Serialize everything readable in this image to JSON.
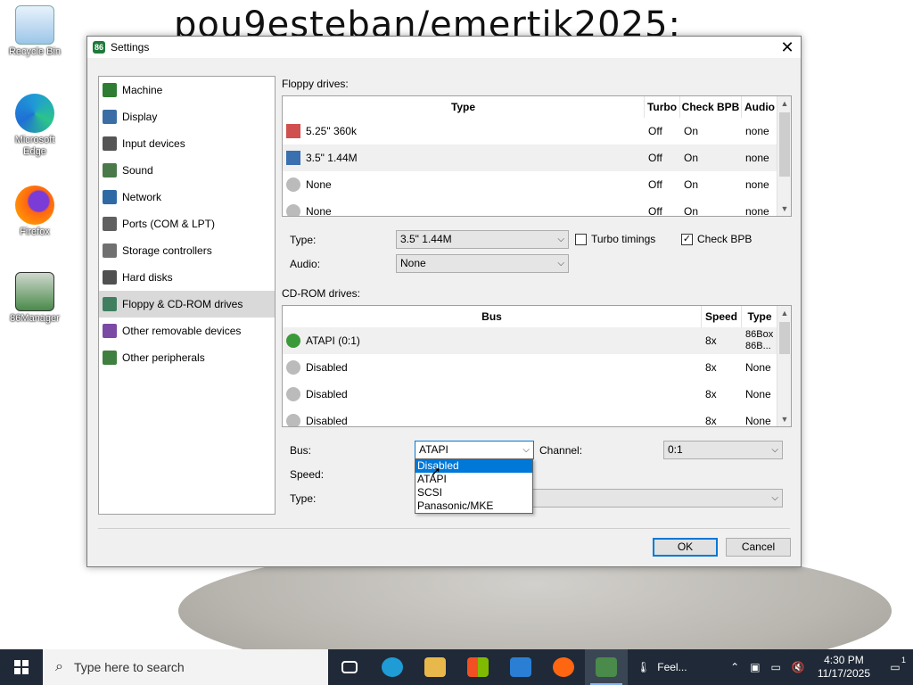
{
  "desktop": {
    "wallpaper_text": "pou9esteban/emertik2025:",
    "icons": [
      {
        "label": "Recycle Bin",
        "color": "#6aa8d8"
      },
      {
        "label": "Microsoft Edge",
        "color": "#1f9bd6"
      },
      {
        "label": "Firefox",
        "color": "#ff6611"
      },
      {
        "label": "86Manager",
        "color": "#4a8a4a"
      }
    ]
  },
  "dialog": {
    "title": "Settings",
    "close_glyph": "✕",
    "nav": [
      {
        "label": "Machine",
        "color": "#2f7d32"
      },
      {
        "label": "Display",
        "color": "#3b6ea5"
      },
      {
        "label": "Input devices",
        "color": "#555555"
      },
      {
        "label": "Sound",
        "color": "#4a7a4a"
      },
      {
        "label": "Network",
        "color": "#2f6aa5"
      },
      {
        "label": "Ports (COM & LPT)",
        "color": "#606060"
      },
      {
        "label": "Storage controllers",
        "color": "#707070"
      },
      {
        "label": "Hard disks",
        "color": "#505050"
      },
      {
        "label": "Floppy & CD-ROM drives",
        "color": "#3f7f5f"
      },
      {
        "label": "Other removable devices",
        "color": "#7a4aa5"
      },
      {
        "label": "Other peripherals",
        "color": "#3f7f3f"
      }
    ],
    "floppy": {
      "section_label": "Floppy drives:",
      "headers": {
        "type": "Type",
        "turbo": "Turbo",
        "check_bpb": "Check BPB",
        "audio": "Audio"
      },
      "rows": [
        {
          "type": "5.25\" 360k",
          "turbo": "Off",
          "check_bpb": "On",
          "audio": "none",
          "icon": "floppy-525-icon",
          "color": "#d05050"
        },
        {
          "type": "3.5\" 1.44M",
          "turbo": "Off",
          "check_bpb": "On",
          "audio": "none",
          "icon": "floppy-35-icon",
          "color": "#3a6fb0"
        },
        {
          "type": "None",
          "turbo": "Off",
          "check_bpb": "On",
          "audio": "none",
          "icon": "floppy-disabled-icon",
          "color": "#999999"
        },
        {
          "type": "None",
          "turbo": "Off",
          "check_bpb": "On",
          "audio": "none",
          "icon": "floppy-disabled-icon",
          "color": "#999999"
        }
      ],
      "type_label": "Type:",
      "type_value": "3.5\" 1.44M",
      "turbo_label": "Turbo timings",
      "turbo_checked": false,
      "check_bpb_label": "Check BPB",
      "check_bpb_checked": true,
      "audio_label": "Audio:",
      "audio_value": "None"
    },
    "cdrom": {
      "section_label": "CD-ROM drives:",
      "headers": {
        "bus": "Bus",
        "speed": "Speed",
        "type": "Type"
      },
      "rows": [
        {
          "bus": "ATAPI (0:1)",
          "speed": "8x",
          "type": "86Box 86B...",
          "color": "#3a9a3a"
        },
        {
          "bus": "Disabled",
          "speed": "8x",
          "type": "None",
          "color": "#999999"
        },
        {
          "bus": "Disabled",
          "speed": "8x",
          "type": "None",
          "color": "#999999"
        },
        {
          "bus": "Disabled",
          "speed": "8x",
          "type": "None",
          "color": "#999999"
        }
      ],
      "bus_label": "Bus:",
      "bus_value": "ATAPI",
      "channel_label": "Channel:",
      "channel_value": "0:1",
      "speed_label": "Speed:",
      "type_label": "Type:",
      "bus_options": [
        "Disabled",
        "ATAPI",
        "SCSI",
        "Panasonic/MKE"
      ],
      "bus_highlighted": "Disabled"
    },
    "ok_label": "OK",
    "cancel_label": "Cancel"
  },
  "taskbar": {
    "search_placeholder": "Type here to search",
    "weather_label": "Feel...",
    "time": "4:30 PM",
    "date": "11/17/2025",
    "notification_count": "1",
    "apps": [
      {
        "name": "task-view-icon",
        "color": "#ffffff"
      },
      {
        "name": "edge-icon",
        "color": "#1f9bd6"
      },
      {
        "name": "file-explorer-icon",
        "color": "#e8b84a"
      },
      {
        "name": "store-icon",
        "color": "#f25022"
      },
      {
        "name": "mail-icon",
        "color": "#2a7fd4"
      },
      {
        "name": "firefox-icon",
        "color": "#ff6611"
      },
      {
        "name": "86box-icon",
        "color": "#4a8a4a"
      }
    ]
  }
}
